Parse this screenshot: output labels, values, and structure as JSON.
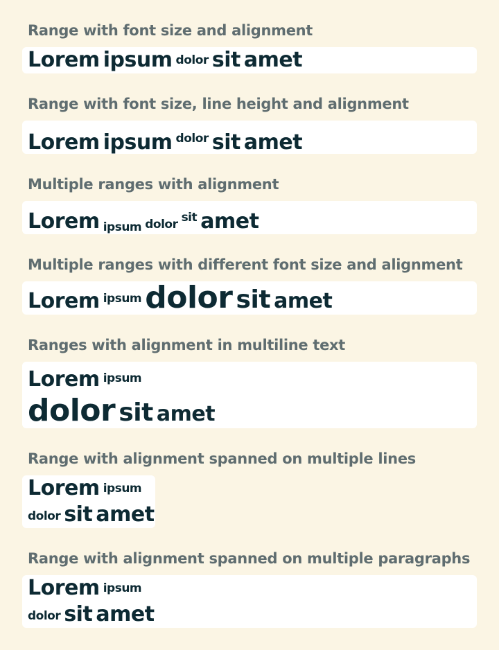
{
  "sections": [
    {
      "caption": "Range with font size and alignment",
      "words": [
        "Lorem",
        "ipsum",
        "dolor",
        "sit",
        "amet"
      ]
    },
    {
      "caption": "Range with font size, line height and alignment",
      "words": [
        "Lorem",
        "ipsum",
        "dolor",
        "sit",
        "amet"
      ]
    },
    {
      "caption": "Multiple ranges with alignment",
      "words": [
        "Lorem",
        "ipsum",
        "dolor",
        "sit",
        "amet"
      ]
    },
    {
      "caption": "Multiple ranges with different font size and alignment",
      "words": [
        "Lorem",
        "ipsum",
        "dolor",
        "sit",
        "amet"
      ]
    },
    {
      "caption": "Ranges with alignment in multiline text",
      "words": [
        "Lorem",
        "ipsum",
        "dolor",
        "sit",
        "amet"
      ]
    },
    {
      "caption": "Range with alignment spanned on multiple lines",
      "words": [
        "Lorem",
        "ipsum",
        "dolor",
        "sit",
        "amet"
      ]
    },
    {
      "caption": "Range with alignment spanned on multiple paragraphs",
      "words": [
        "Lorem",
        "ipsum",
        "dolor",
        "sit",
        "amet"
      ]
    }
  ],
  "colors": {
    "background": "#fbf5e4",
    "card": "#ffffff",
    "caption": "#5f6d70",
    "text": "#0d2a33"
  }
}
